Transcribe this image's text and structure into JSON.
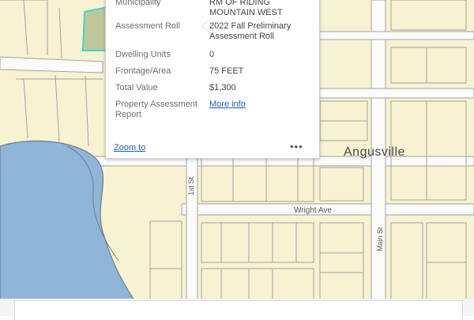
{
  "map": {
    "town_label": "Angusville",
    "streets": {
      "first": "1st St",
      "wright": "Wright Ave",
      "main": "Main St"
    },
    "colors": {
      "land": "#f7f3d2",
      "parcel_line": "#a2a2a2",
      "road": "#fbfbf9",
      "lake": "#8fb5d9",
      "shore": "#6b7f8f",
      "selected_fill": "#bfc79a",
      "selected_outline": "#3ad9c4"
    }
  },
  "popup": {
    "rows": [
      {
        "label": "Municipality",
        "value": "RM OF RIDING MOUNTAIN WEST"
      },
      {
        "label": "Assessment Roll",
        "value": "2022 Fall Preliminary Assessment Roll"
      },
      {
        "label": "Dwelling Units",
        "value": "0"
      },
      {
        "label": "Frontage/Area",
        "value": "75 FEET"
      },
      {
        "label": "Total Value",
        "value": "$1,300"
      },
      {
        "label": "Property Assessment Report",
        "value": "More info"
      }
    ],
    "zoom_to": "Zoom to",
    "menu_icon": "more-options-icon"
  }
}
